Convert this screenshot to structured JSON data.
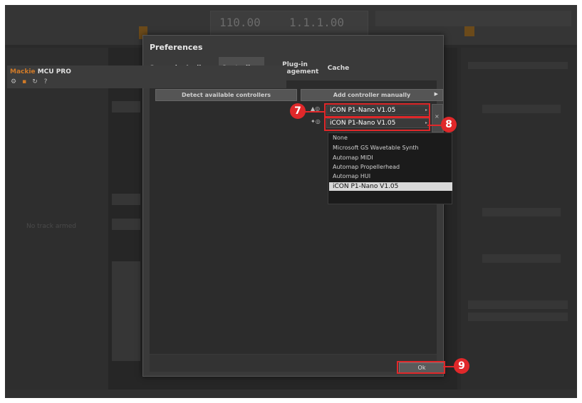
{
  "dialog": {
    "title": "Preferences",
    "tabs": [
      {
        "label": "General"
      },
      {
        "label": "Audio"
      },
      {
        "label": "Controllers"
      },
      {
        "label": "Plug-in management"
      },
      {
        "label": "Cache"
      }
    ],
    "active_tab": "Controllers",
    "detect_button": "Detect available controllers",
    "add_button": "Add controller manually",
    "controller": {
      "brand": "Mackie",
      "model": "MCU PRO"
    },
    "selects": [
      {
        "value": "iCON P1-Nano V1.05"
      },
      {
        "value": "iCON P1-Nano V1.05"
      }
    ],
    "dropdown_options": [
      "None",
      "Microsoft GS Wavetable Synth",
      "Automap MIDI",
      "Automap Propellerhead",
      "Automap HUI",
      "iCON P1-Nano V1.05"
    ],
    "selected_option": "iCON P1-Nano V1.05",
    "ok_button": "Ok"
  },
  "callouts": [
    "7",
    "8",
    "9"
  ],
  "background": {
    "time1": "110.00",
    "time2": "1.1.1.00",
    "left_text": "No track armed"
  },
  "colors": {
    "callout": "#e0282a",
    "brand": "#d07a28"
  }
}
